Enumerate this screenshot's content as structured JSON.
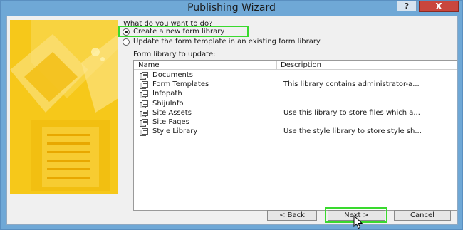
{
  "window": {
    "title": "Publishing Wizard",
    "help_label": "?",
    "close_label": "X"
  },
  "prompt": {
    "question": "What do you want to do?",
    "option_create": "Create a new form library",
    "option_update": "Update the form template in an existing form library",
    "selected": "create"
  },
  "library": {
    "label": "Form library to update:",
    "columns": [
      "Name",
      "Description"
    ],
    "rows": [
      {
        "name": "Documents",
        "description": ""
      },
      {
        "name": "Form Templates",
        "description": "This library contains administrator-a..."
      },
      {
        "name": "Infopath",
        "description": ""
      },
      {
        "name": "ShijuInfo",
        "description": ""
      },
      {
        "name": "Site Assets",
        "description": "Use this library to store files which a..."
      },
      {
        "name": "Site Pages",
        "description": ""
      },
      {
        "name": "Style Library",
        "description": "Use the style library to store style sh..."
      }
    ]
  },
  "buttons": {
    "back": "< Back",
    "next": "Next >",
    "cancel": "Cancel"
  },
  "colors": {
    "titlebar": "#6fa8d6",
    "banner": "#f6c81a",
    "highlight": "#39d92e",
    "close": "#c9463d"
  }
}
